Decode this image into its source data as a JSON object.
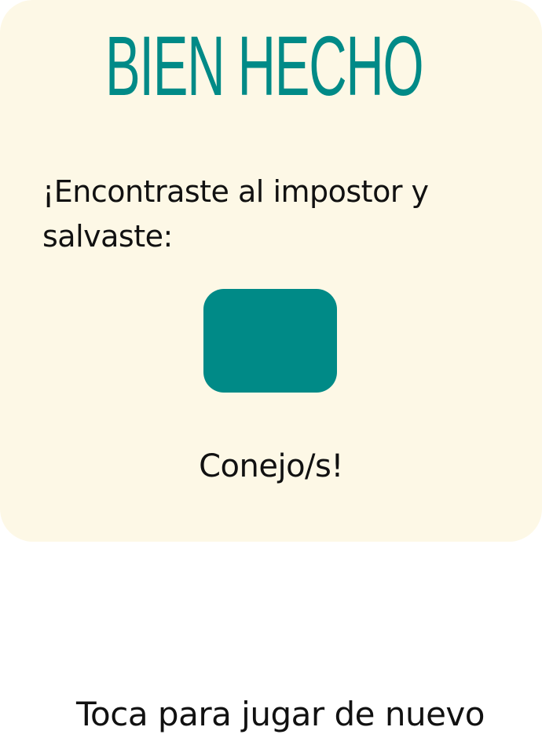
{
  "colors": {
    "card_background": "#fdf8e6",
    "accent": "#008a87",
    "text": "#111111",
    "page_background": "#ffffff"
  },
  "result": {
    "title": "BIEN HECHO",
    "message": "¡Encontraste al impostor y salvaste:",
    "reward_label": "Conejo/s!"
  },
  "footer": {
    "play_again_label": "Toca para jugar de nuevo"
  }
}
